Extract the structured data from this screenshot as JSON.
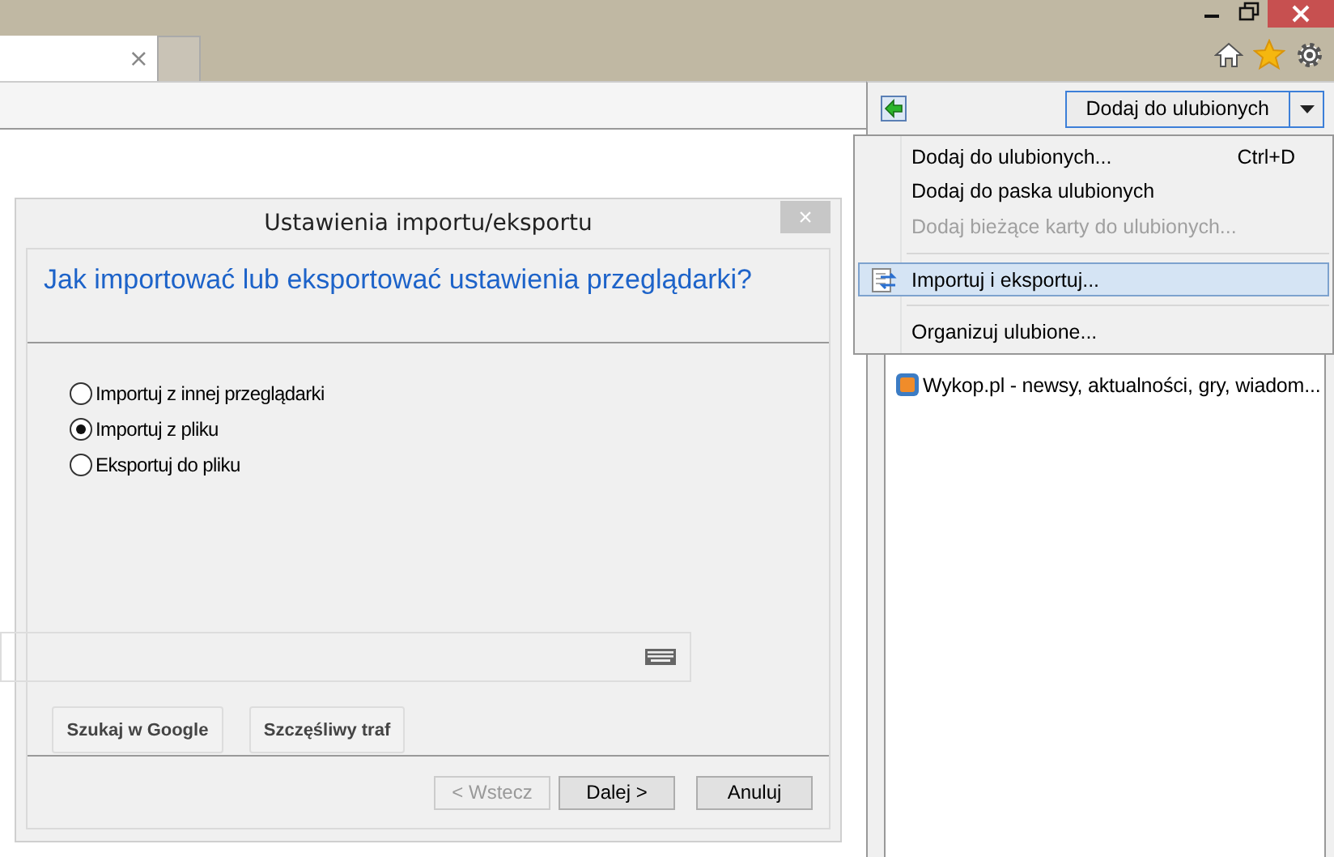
{
  "browser": {
    "tab": {
      "close": "×"
    }
  },
  "favorites_panel": {
    "add_button": "Dodaj do ulubionych",
    "items": [
      {
        "title": "Wykop.pl - newsy, aktualności, gry, wiadom..."
      }
    ]
  },
  "menu": {
    "items": [
      {
        "kind": "item",
        "label": "Dodaj do ulubionych...",
        "shortcut": "Ctrl+D",
        "disabled": false,
        "selected": false
      },
      {
        "kind": "item",
        "label": "Dodaj do paska ulubionych",
        "disabled": false,
        "selected": false
      },
      {
        "kind": "item",
        "label": "Dodaj bieżące karty do ulubionych...",
        "disabled": true,
        "selected": false
      },
      {
        "kind": "separator"
      },
      {
        "kind": "item",
        "label": "Importuj i eksportuj...",
        "icon": true,
        "disabled": false,
        "selected": true
      },
      {
        "kind": "separator"
      },
      {
        "kind": "item",
        "label": "Organizuj ulubione...",
        "disabled": false,
        "selected": false
      }
    ]
  },
  "dialog": {
    "title": "Ustawienia importu/eksportu",
    "close": "×",
    "heading": "Jak importować lub eksportować ustawienia przeglądarki?",
    "options": [
      {
        "label": "Importuj z innej przeglądarki",
        "selected": false
      },
      {
        "label": "Importuj z pliku",
        "selected": true
      },
      {
        "label": "Eksportuj do pliku",
        "selected": false
      }
    ],
    "buttons": [
      {
        "label": "< Wstecz",
        "disabled": true
      },
      {
        "label": "Dalej >",
        "disabled": false
      },
      {
        "label": "Anuluj",
        "disabled": false
      }
    ]
  },
  "google_page": {
    "buttons": [
      "Szukaj w Google",
      "Szczęśliwy traf"
    ]
  }
}
